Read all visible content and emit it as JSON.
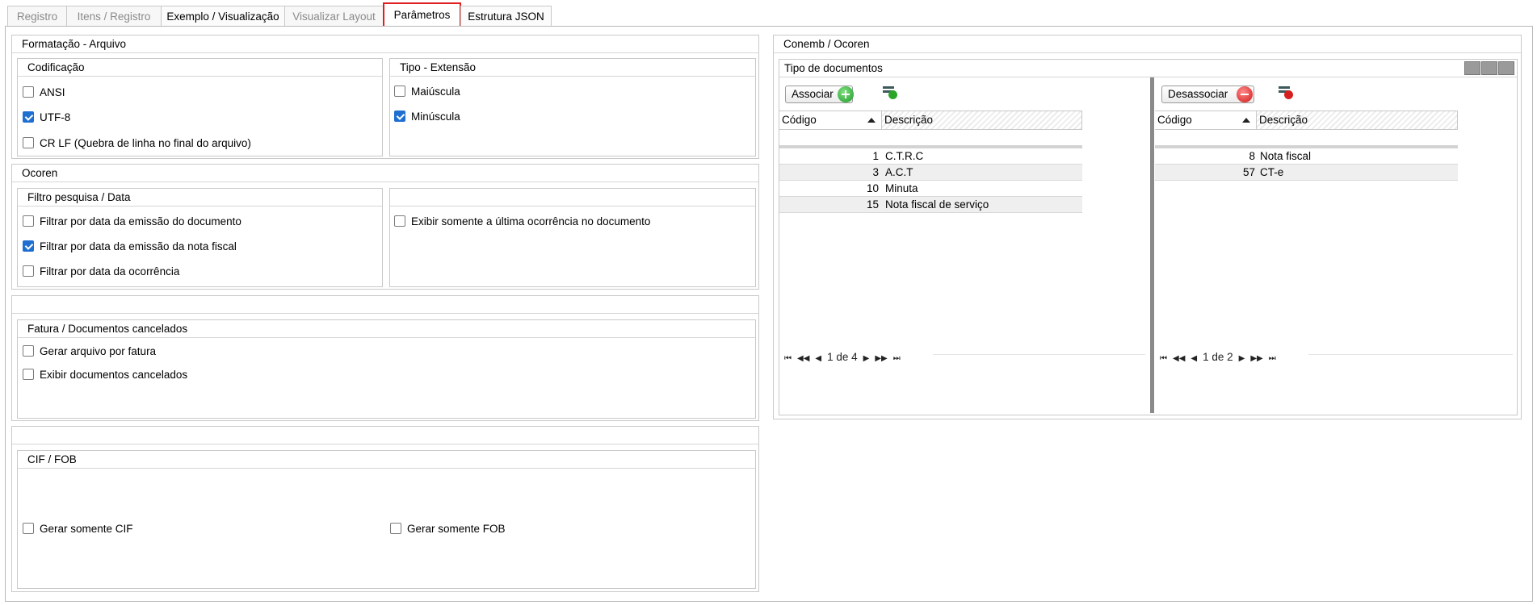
{
  "tabs": [
    {
      "label": "Registro",
      "state": "disabled"
    },
    {
      "label": "Itens / Registro",
      "state": "disabled"
    },
    {
      "label": "Exemplo / Visualização",
      "state": "enabled"
    },
    {
      "label": "Visualizar Layout",
      "state": "disabled"
    },
    {
      "label": "Parâmetros",
      "state": "active"
    },
    {
      "label": "Estrutura JSON",
      "state": "enabled"
    }
  ],
  "formatacao": {
    "title": "Formatação - Arquivo",
    "codificacao": {
      "title": "Codificação",
      "options": [
        {
          "label": "ANSI",
          "checked": false
        },
        {
          "label": "UTF-8",
          "checked": true
        },
        {
          "label": "CR LF (Quebra de linha no final do arquivo)",
          "checked": false
        }
      ]
    },
    "tipo": {
      "title": "Tipo - Extensão",
      "options": [
        {
          "label": "Maiúscula",
          "checked": false
        },
        {
          "label": "Minúscula",
          "checked": true
        }
      ]
    }
  },
  "ocoren": {
    "title": "Ocoren",
    "filtro": {
      "title": "Filtro pesquisa / Data",
      "options": [
        {
          "label": "Filtrar por data da emissão do documento",
          "checked": false
        },
        {
          "label": "Filtrar por data da emissão da nota fiscal",
          "checked": true
        },
        {
          "label": "Filtrar por data da ocorrência",
          "checked": false
        }
      ]
    },
    "exibir_ultima": {
      "label": "Exibir somente a última ocorrência no documento",
      "checked": false
    }
  },
  "fatura": {
    "title": "Fatura / Documentos cancelados",
    "options": [
      {
        "label": "Gerar arquivo por fatura",
        "checked": false
      },
      {
        "label": "Exibir documentos cancelados",
        "checked": false
      }
    ]
  },
  "cif_fob": {
    "title": "CIF / FOB",
    "cif": {
      "label": "Gerar somente CIF",
      "checked": false
    },
    "fob": {
      "label": "Gerar somente FOB",
      "checked": false
    }
  },
  "conemb": {
    "title": "Conemb / Ocoren",
    "tipo_documentos": "Tipo de documentos",
    "left": {
      "button": "Associar",
      "headers": {
        "codigo": "Código",
        "descricao": "Descrição"
      },
      "rows": [
        {
          "codigo": "1",
          "descricao": "C.T.R.C"
        },
        {
          "codigo": "3",
          "descricao": "A.C.T"
        },
        {
          "codigo": "10",
          "descricao": "Minuta"
        },
        {
          "codigo": "15",
          "descricao": "Nota fiscal de serviço"
        }
      ],
      "pager": "1 de 4"
    },
    "right": {
      "button": "Desassociar",
      "headers": {
        "codigo": "Código",
        "descricao": "Descrição"
      },
      "rows": [
        {
          "codigo": "8",
          "descricao": "Nota fiscal"
        },
        {
          "codigo": "57",
          "descricao": "CT-e"
        }
      ],
      "pager": "1 de 2"
    }
  },
  "colors": {
    "active_tab_border": "#e02020",
    "checkbox_checked": "#1f6fd1"
  }
}
